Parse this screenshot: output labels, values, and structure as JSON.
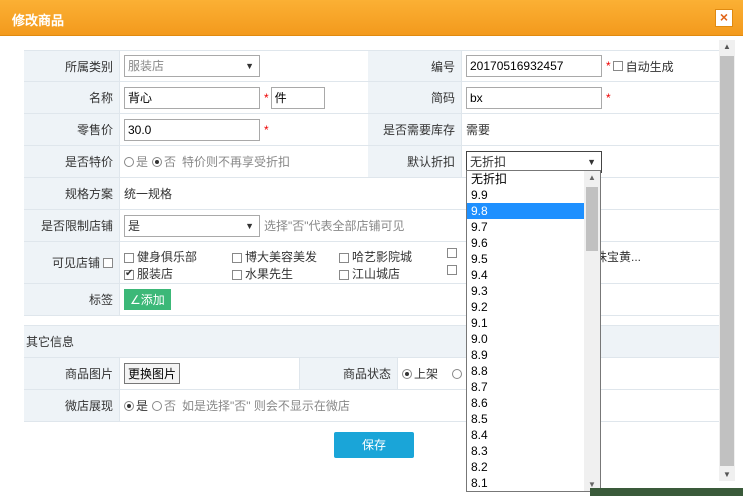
{
  "dialog": {
    "title": "修改商品",
    "close_glyph": "×"
  },
  "colors": {
    "title_bar": "#f5a623",
    "save_button": "#1aa5d8",
    "add_tag_button": "#3cb878",
    "dropdown_highlight": "#1e90ff"
  },
  "form": {
    "category": {
      "label": "所属类别",
      "value": "服装店"
    },
    "code": {
      "label": "编号",
      "value": "20170516932457",
      "auto_label": "自动生成"
    },
    "name": {
      "label": "名称",
      "value": "背心",
      "unit_value": "件"
    },
    "short_code": {
      "label": "简码",
      "value": "bx"
    },
    "retail_price": {
      "label": "零售价",
      "value": "30.0"
    },
    "need_stock": {
      "label": "是否需要库存",
      "value": "需要"
    },
    "special_price": {
      "label": "是否特价",
      "yes": "是",
      "no": "否",
      "hint": "特价则不再享受折扣"
    },
    "default_discount": {
      "label": "默认折扣",
      "value": "无折扣"
    },
    "spec_plan": {
      "label": "规格方案",
      "value": "统一规格"
    },
    "limit_store": {
      "label": "是否限制店铺",
      "value": "是",
      "hint": "选择\"否\"代表全部店铺可见"
    },
    "visible_stores": {
      "label": "可见店铺",
      "stores": [
        {
          "name": "健身俱乐部",
          "checked": false
        },
        {
          "name": "博大美容美发",
          "checked": false
        },
        {
          "name": "哈艺影院城",
          "checked": false
        },
        {
          "name": "服装店",
          "checked": true
        },
        {
          "name": "水果先生",
          "checked": false
        },
        {
          "name": "江山城店",
          "checked": false
        }
      ],
      "truncated_store": "珠宝黄..."
    },
    "tags": {
      "label": "标签",
      "add_label": "∠添加"
    }
  },
  "other_info": {
    "section_title": "其它信息",
    "image": {
      "label": "商品图片",
      "button": "更换图片"
    },
    "status": {
      "label": "商品状态",
      "option_on": "上架"
    },
    "micro_store": {
      "label": "微店展现",
      "yes": "是",
      "no": "否",
      "hint": "如是选择\"否\" 则会不显示在微店"
    }
  },
  "save_label": "保存",
  "discount_options": [
    "无折扣",
    "9.9",
    "9.8",
    "9.7",
    "9.6",
    "9.5",
    "9.4",
    "9.3",
    "9.2",
    "9.1",
    "9.0",
    "8.9",
    "8.8",
    "8.7",
    "8.6",
    "8.5",
    "8.4",
    "8.3",
    "8.2",
    "8.1"
  ],
  "discount_highlighted": "9.8"
}
